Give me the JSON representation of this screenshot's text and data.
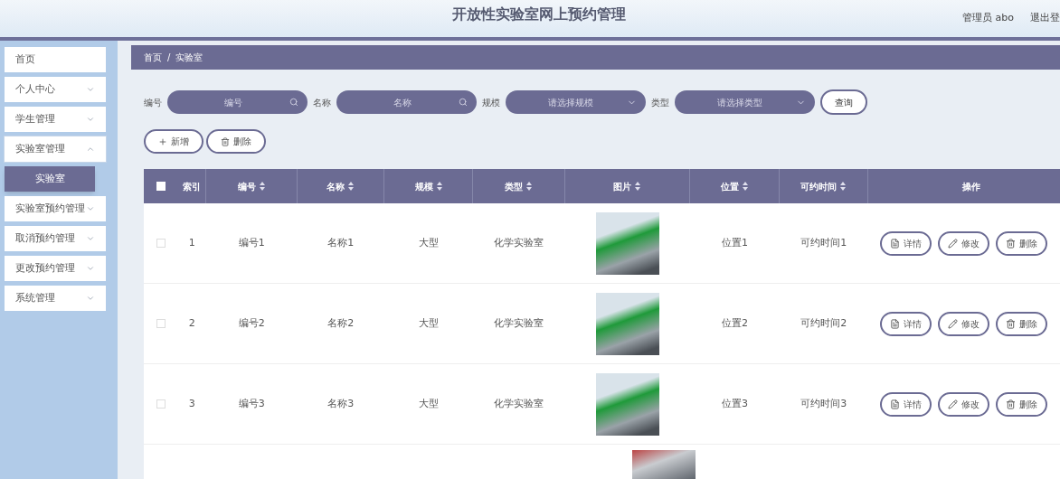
{
  "header": {
    "title": "开放性实验室网上预约管理",
    "user": "管理员 abo",
    "logout": "退出登"
  },
  "sidebar": {
    "items": [
      {
        "kind": "link",
        "label": "首页",
        "expanded": false
      },
      {
        "kind": "menu",
        "label": "个人中心",
        "expanded": false
      },
      {
        "kind": "menu",
        "label": "学生管理",
        "expanded": false
      },
      {
        "kind": "menu",
        "label": "实验室管理",
        "expanded": true,
        "children": [
          {
            "label": "实验室",
            "selected": true
          }
        ]
      },
      {
        "kind": "menu",
        "label": "实验室预约管理",
        "expanded": false
      },
      {
        "kind": "menu",
        "label": "取消预约管理",
        "expanded": false
      },
      {
        "kind": "menu",
        "label": "更改预约管理",
        "expanded": false
      },
      {
        "kind": "menu",
        "label": "系统管理",
        "expanded": false
      }
    ]
  },
  "breadcrumb": [
    "首页",
    "/",
    "实验室"
  ],
  "filters": [
    {
      "kind": "search",
      "label": "编号",
      "placeholder": "编号"
    },
    {
      "kind": "search",
      "label": "名称",
      "placeholder": "名称"
    },
    {
      "kind": "select",
      "label": "规模",
      "placeholder": "请选择规模"
    },
    {
      "kind": "select",
      "label": "类型",
      "placeholder": "请选择类型"
    }
  ],
  "query_button": "查询",
  "toolbar": [
    {
      "kind": "add",
      "label": "新增"
    },
    {
      "kind": "delete",
      "label": "删除"
    }
  ],
  "table": {
    "select_all_checked": false,
    "columns": [
      {
        "label": "索引",
        "sortable": false
      },
      {
        "label": "编号",
        "sortable": true
      },
      {
        "label": "名称",
        "sortable": true
      },
      {
        "label": "规模",
        "sortable": true
      },
      {
        "label": "类型",
        "sortable": true
      },
      {
        "label": "图片",
        "sortable": true
      },
      {
        "label": "位置",
        "sortable": true
      },
      {
        "label": "可约时间",
        "sortable": true
      },
      {
        "label": "操作",
        "sortable": false
      }
    ],
    "rows": [
      {
        "checked": false,
        "index": "1",
        "code": "编号1",
        "name": "名称1",
        "scale": "大型",
        "type": "化学实验室",
        "location": "位置1",
        "time": "可约时间1",
        "actions": [
          {
            "kind": "detail",
            "label": "详情"
          },
          {
            "kind": "edit",
            "label": "修改"
          },
          {
            "kind": "delete",
            "label": "删除"
          }
        ]
      },
      {
        "checked": false,
        "index": "2",
        "code": "编号2",
        "name": "名称2",
        "scale": "大型",
        "type": "化学实验室",
        "location": "位置2",
        "time": "可约时间2",
        "actions": [
          {
            "kind": "detail",
            "label": "详情"
          },
          {
            "kind": "edit",
            "label": "修改"
          },
          {
            "kind": "delete",
            "label": "删除"
          }
        ]
      },
      {
        "checked": false,
        "index": "3",
        "code": "编号3",
        "name": "名称3",
        "scale": "大型",
        "type": "化学实验室",
        "location": "位置3",
        "time": "可约时间3",
        "actions": [
          {
            "kind": "detail",
            "label": "详情"
          },
          {
            "kind": "edit",
            "label": "修改"
          },
          {
            "kind": "delete",
            "label": "删除"
          }
        ]
      }
    ]
  }
}
